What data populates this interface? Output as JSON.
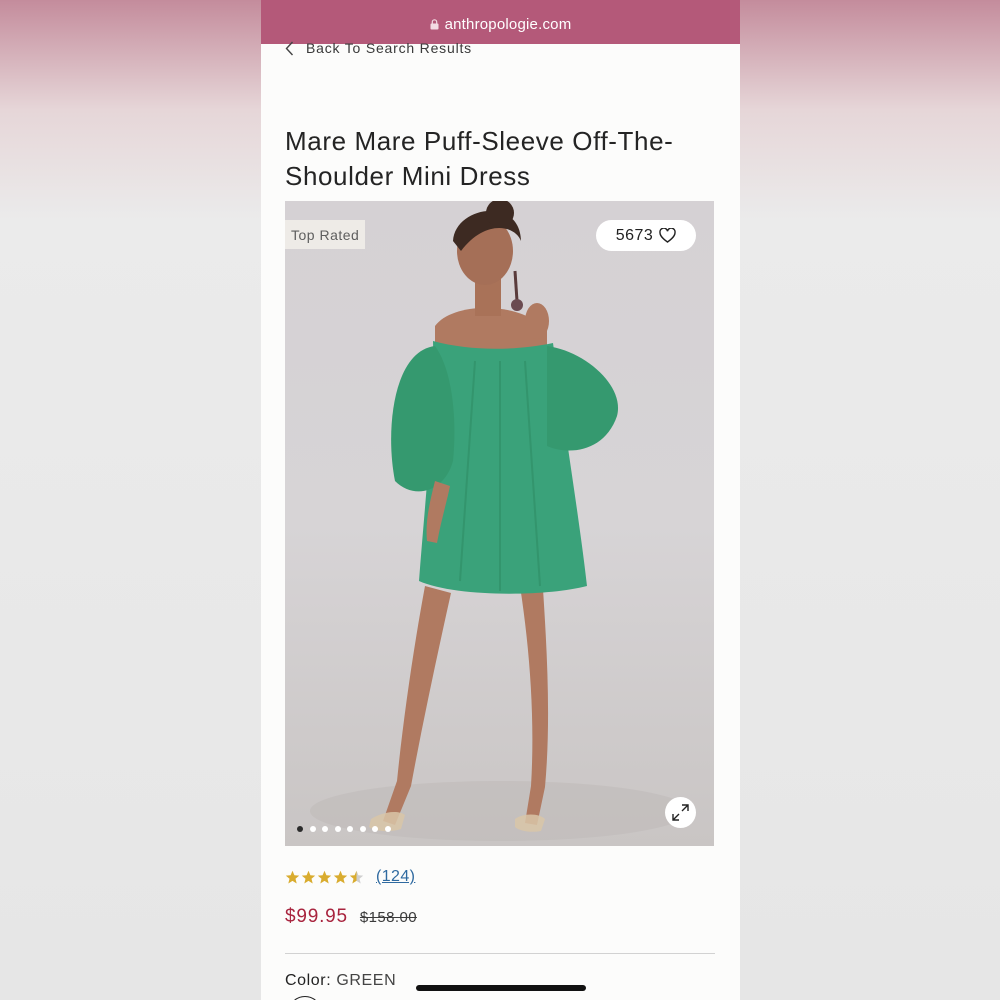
{
  "browser": {
    "url": "anthropologie.com"
  },
  "nav": {
    "back_label": "Back To Search Results"
  },
  "product": {
    "title": "Mare Mare Puff-Sleeve Off-The-Shoulder Mini Dress",
    "badge": "Top Rated",
    "likes": "5673",
    "rating": 4.5,
    "review_count": "(124)",
    "sale_price": "$99.95",
    "original_price": "$158.00",
    "color_label": "Color:",
    "color_value": "GREEN",
    "image_count": 8,
    "active_image": 1
  },
  "colors": {
    "brand_bar": "#b45979",
    "sale": "#a8243e",
    "star": "#d9ac2f",
    "dress": "#3aa27a",
    "link": "#2f6aa0"
  },
  "icons": {
    "back": "chevron-left-icon",
    "like": "heart-icon",
    "expand": "expand-icon",
    "lock": "lock-icon"
  }
}
